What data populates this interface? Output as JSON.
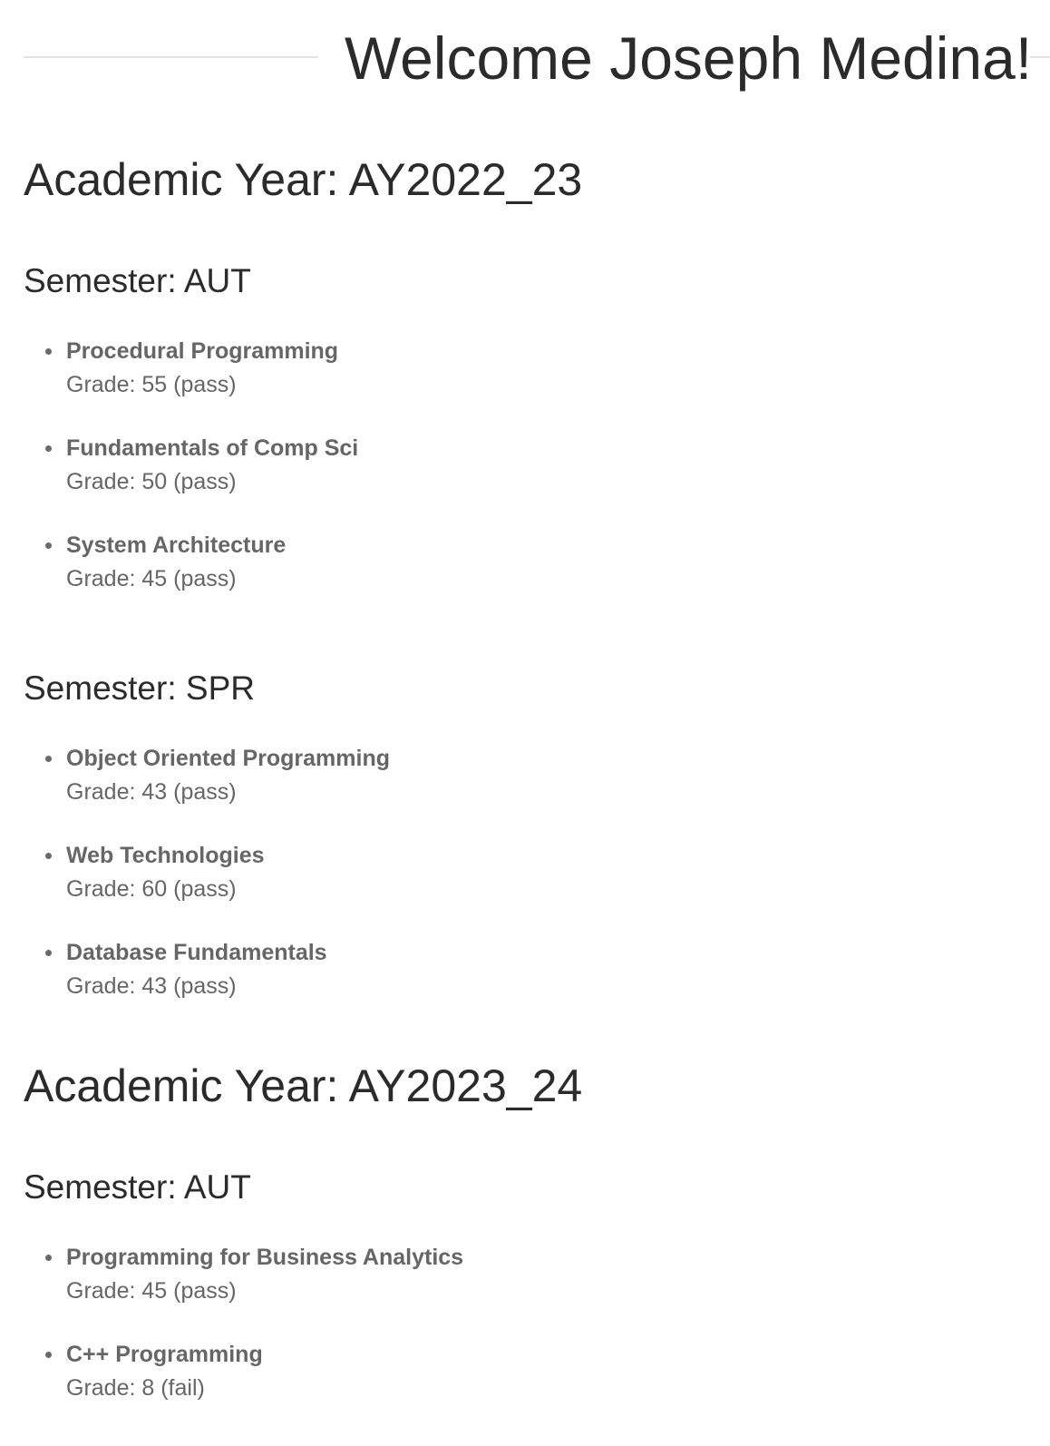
{
  "header": {
    "title": "Welcome Joseph Medina!"
  },
  "years": [
    {
      "label": "Academic Year: AY2022_23",
      "semesters": [
        {
          "label": "Semester: AUT",
          "modules": [
            {
              "name": "Procedural Programming",
              "grade": "Grade: 55 (pass)"
            },
            {
              "name": "Fundamentals of Comp Sci",
              "grade": "Grade: 50 (pass)"
            },
            {
              "name": "System Architecture",
              "grade": "Grade: 45 (pass)"
            }
          ]
        },
        {
          "label": "Semester: SPR",
          "modules": [
            {
              "name": "Object Oriented Programming",
              "grade": "Grade: 43 (pass)"
            },
            {
              "name": "Web Technologies",
              "grade": "Grade: 60 (pass)"
            },
            {
              "name": "Database Fundamentals",
              "grade": "Grade: 43 (pass)"
            }
          ]
        }
      ]
    },
    {
      "label": "Academic Year: AY2023_24",
      "semesters": [
        {
          "label": "Semester: AUT",
          "modules": [
            {
              "name": "Programming for Business Analytics",
              "grade": "Grade: 45 (pass)"
            },
            {
              "name": "C++ Programming",
              "grade": "Grade: 8 (fail)"
            }
          ]
        }
      ]
    }
  ]
}
